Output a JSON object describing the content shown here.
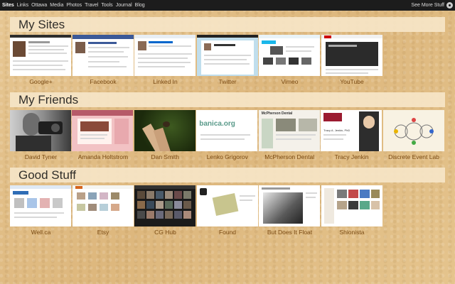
{
  "topbar": {
    "links": [
      "Sites",
      "Links",
      "Ottawa",
      "Media",
      "Photos",
      "Travel",
      "Tools",
      "Journal",
      "Blog"
    ],
    "right_label": "See More Stuff"
  },
  "sections": [
    {
      "title": "My Sites",
      "tiles": [
        "Google+",
        "Facebook",
        "Linked In",
        "Twitter",
        "Vimeo",
        "YouTube"
      ]
    },
    {
      "title": "My Friends",
      "tiles": [
        "David Tyner",
        "Amanda Holtstrom",
        "Dan Smith",
        "Lenko Grigorov",
        "McPherson Dental",
        "Tracy Jenkin",
        "Discrete Event Lab"
      ]
    },
    {
      "title": "Good Stuff",
      "tiles": [
        "Well.ca",
        "Etsy",
        "CG Hub",
        "Found",
        "But Does It Float",
        "Shionista"
      ]
    }
  ],
  "thumb_text": {
    "lenko": "banica.org",
    "mcpherson": "McPherson Dental",
    "tracy": "Tracy A. Jenkin, PhD"
  },
  "colors": {
    "topbar": "#1c1c1c",
    "banner": "#f6e5c7",
    "caption": "#7a4b14",
    "background": "#e3c189"
  }
}
